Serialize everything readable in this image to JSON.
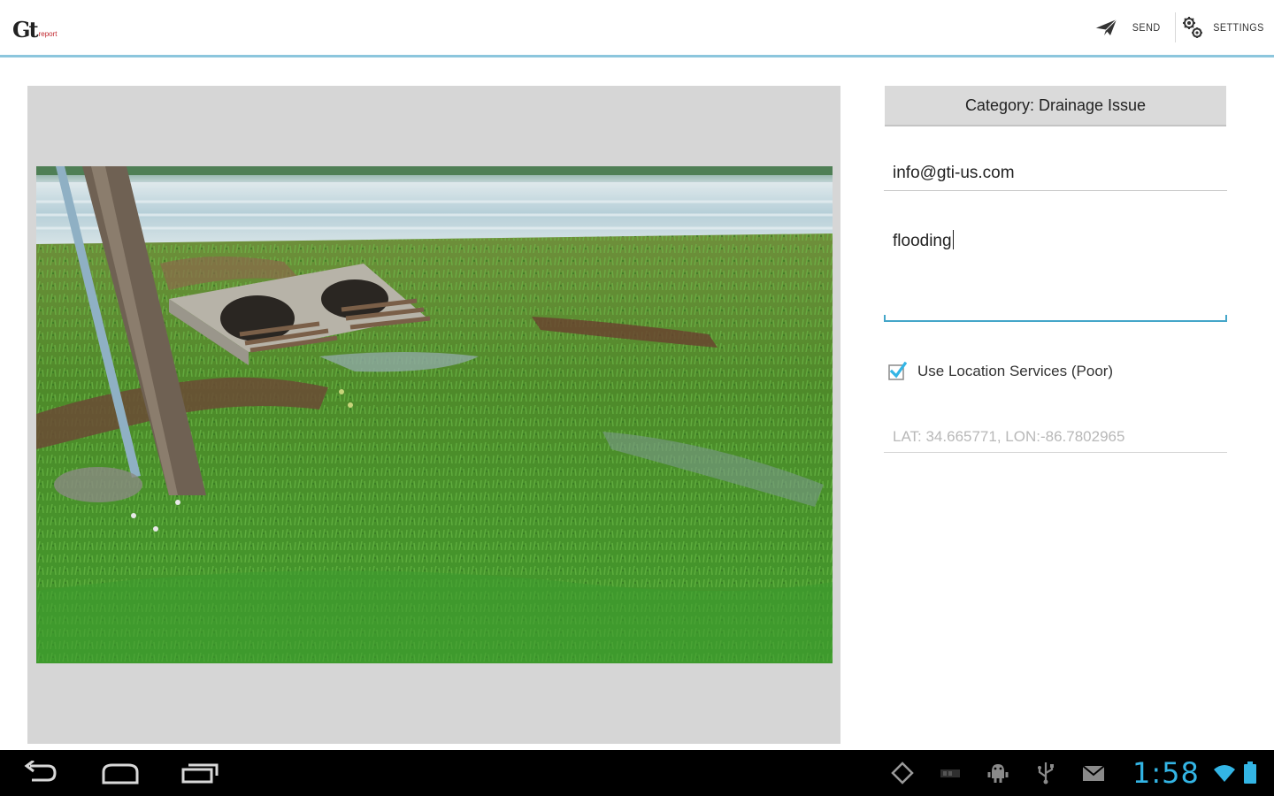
{
  "app": {
    "logo_main": "Gt",
    "logo_sub": "report"
  },
  "action_bar": {
    "send_label": "SEND",
    "settings_label": "SETTINGS",
    "send_icon": "send-icon",
    "settings_icon": "gear-icon",
    "divider_color": "#8cc6dd"
  },
  "photo": {
    "subject": "culvert-photo"
  },
  "form": {
    "category_button": "Category: Drainage Issue",
    "email_value": "info@gti-us.com",
    "description_value": "flooding",
    "location_checkbox_label": "Use Location Services (Poor)",
    "location_checked": true,
    "coordinates_text": "LAT: 34.665771, LON:-86.7802965",
    "accent_color": "#44a6c9"
  },
  "nav_bar": {
    "back_icon": "back-icon",
    "home_icon": "home-icon",
    "recent_icon": "recent-apps-icon"
  },
  "status_bar": {
    "time": "1:58",
    "icons": [
      "location-icon",
      "screenshot-icon",
      "android-debug-icon",
      "usb-icon",
      "mail-icon",
      "wifi-icon",
      "battery-icon"
    ],
    "clock_color": "#33b5e5"
  }
}
